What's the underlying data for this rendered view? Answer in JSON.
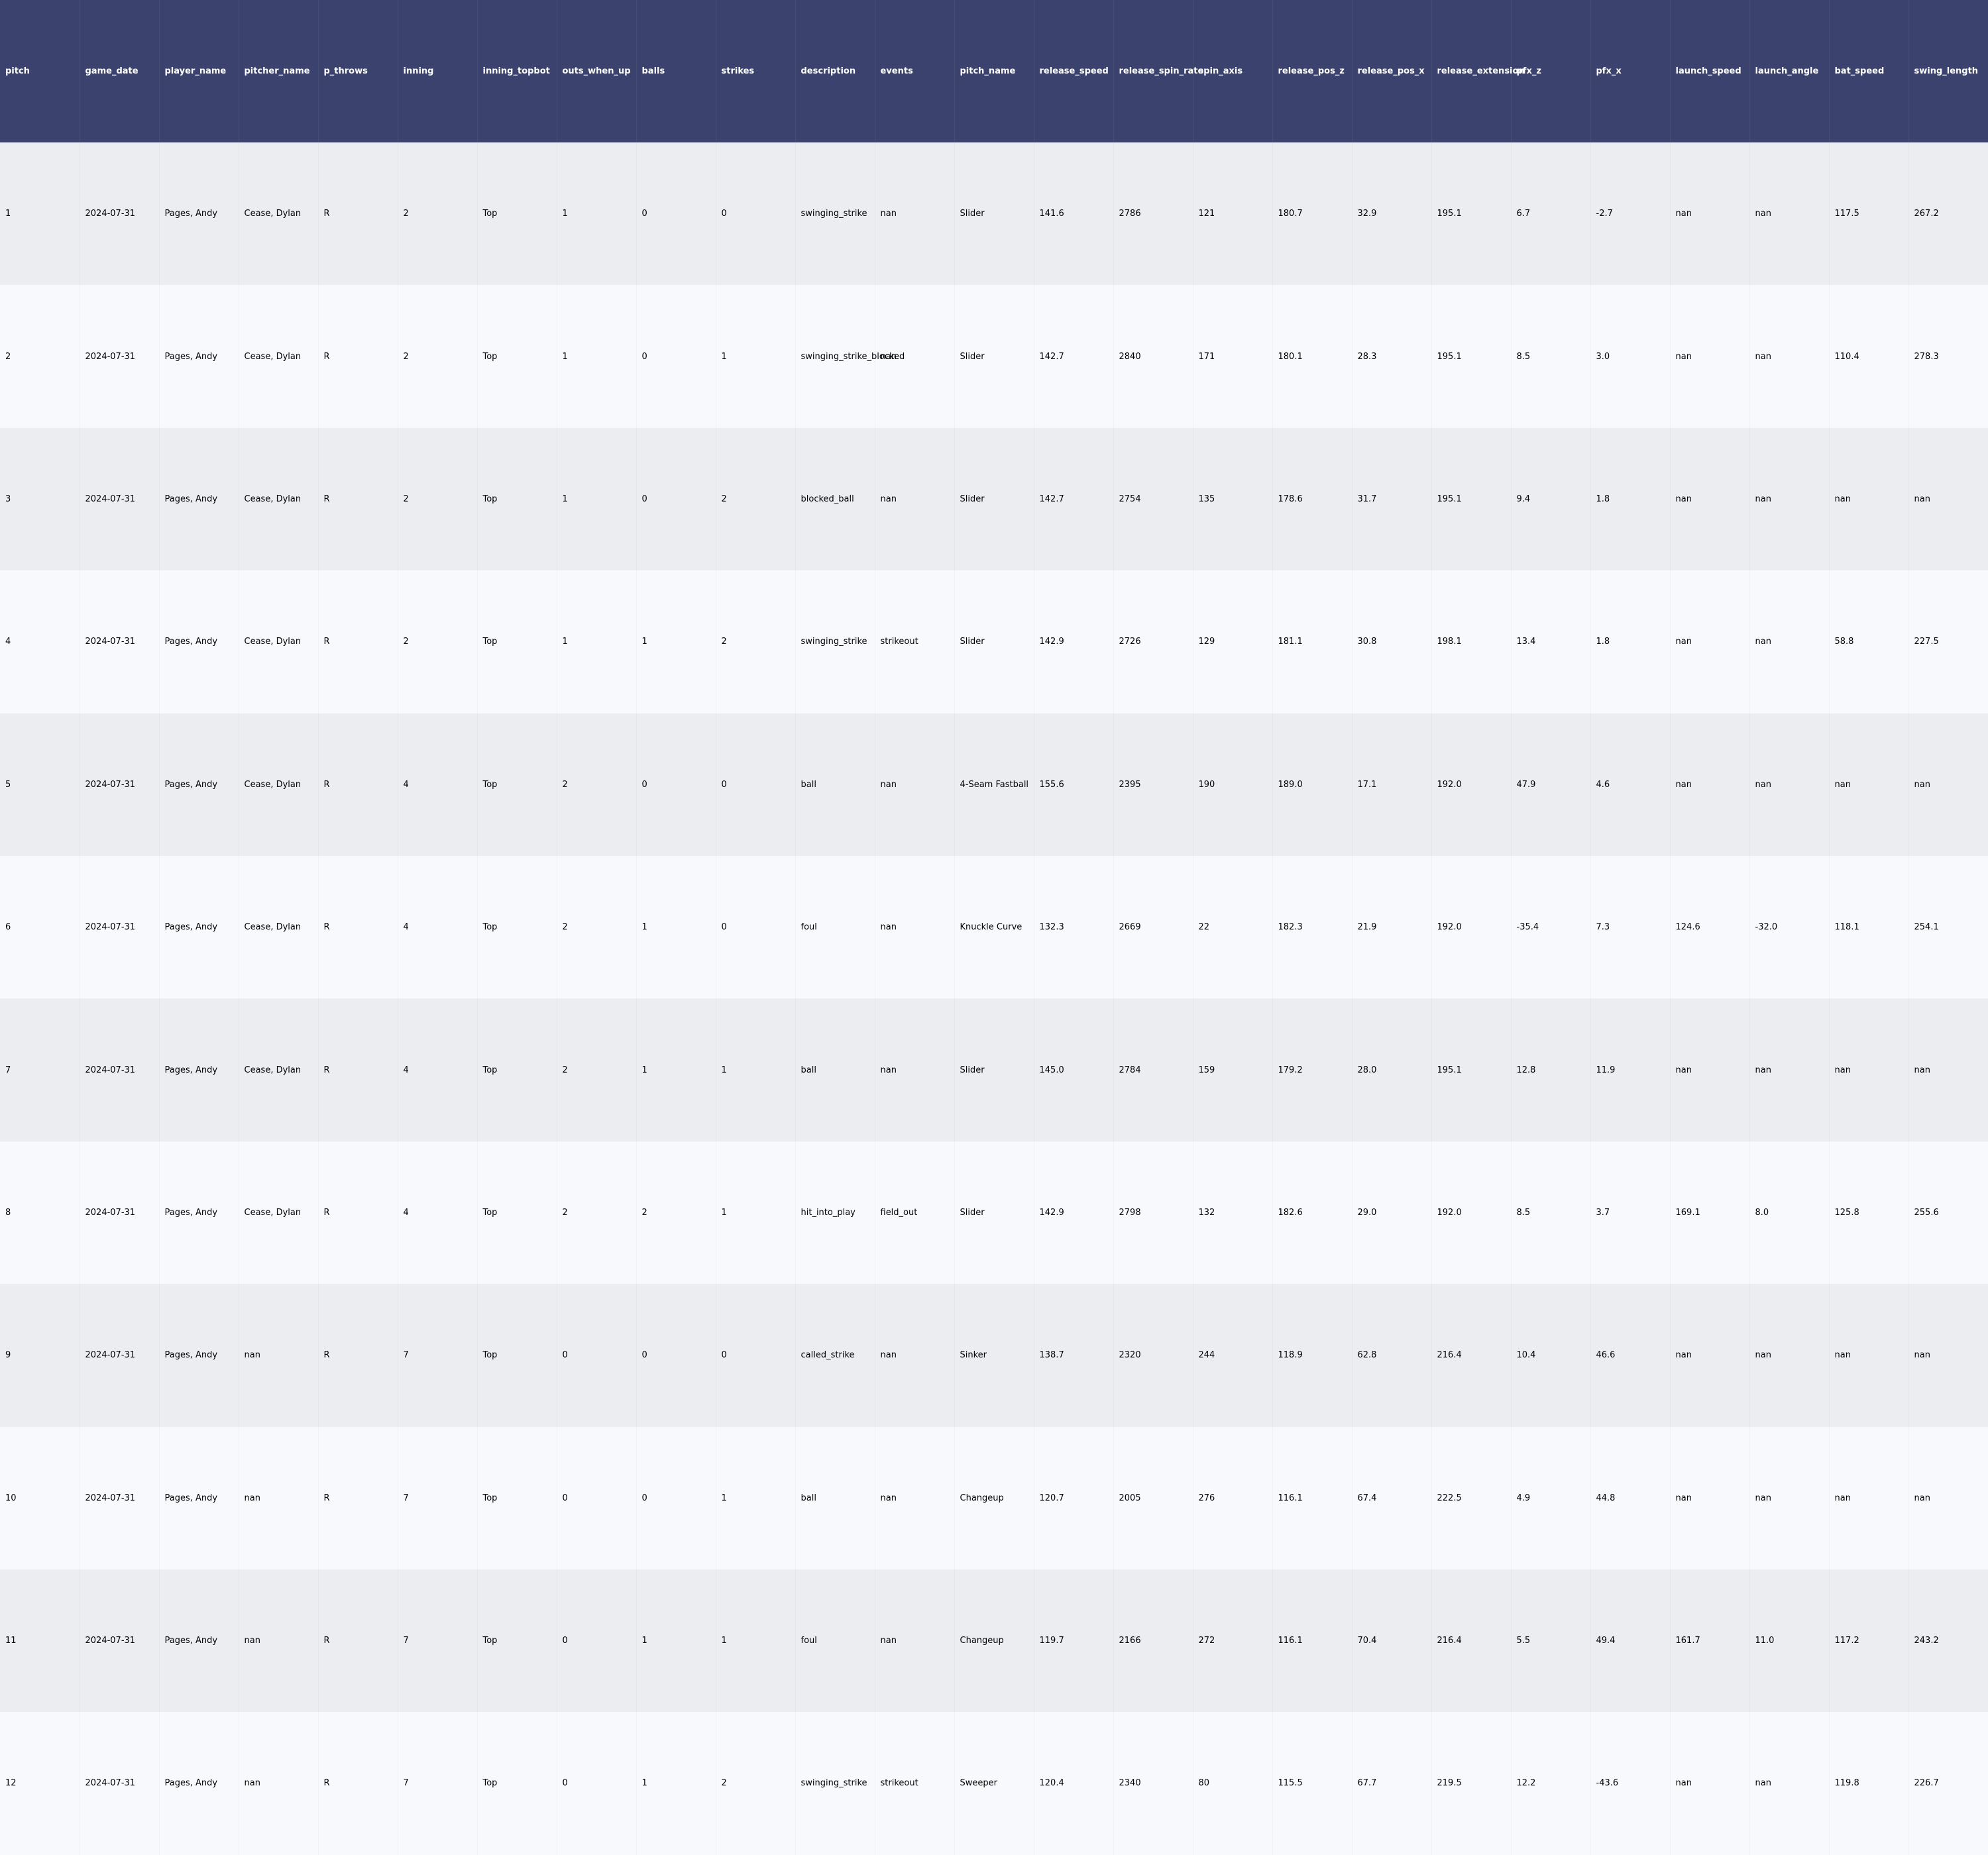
{
  "chart_data": {
    "type": "table",
    "columns": [
      "pitch",
      "game_date",
      "player_name",
      "pitcher_name",
      "p_throws",
      "inning",
      "inning_topbot",
      "outs_when_up",
      "balls",
      "strikes",
      "description",
      "events",
      "pitch_name",
      "release_speed",
      "release_spin_rate",
      "spin_axis",
      "release_pos_z",
      "release_pos_x",
      "release_extension",
      "pfx_z",
      "pfx_x",
      "launch_speed",
      "launch_angle",
      "bat_speed",
      "swing_length"
    ],
    "rows": [
      [
        "1",
        "2024-07-31",
        "Pages, Andy",
        "Cease, Dylan",
        "R",
        "2",
        "Top",
        "1",
        "0",
        "0",
        "swinging_strike",
        "nan",
        "Slider",
        "141.6",
        "2786",
        "121",
        "180.7",
        "32.9",
        "195.1",
        "6.7",
        "-2.7",
        "nan",
        "nan",
        "117.5",
        "267.2"
      ],
      [
        "2",
        "2024-07-31",
        "Pages, Andy",
        "Cease, Dylan",
        "R",
        "2",
        "Top",
        "1",
        "0",
        "1",
        "swinging_strike_blocked",
        "nan",
        "Slider",
        "142.7",
        "2840",
        "171",
        "180.1",
        "28.3",
        "195.1",
        "8.5",
        "3.0",
        "nan",
        "nan",
        "110.4",
        "278.3"
      ],
      [
        "3",
        "2024-07-31",
        "Pages, Andy",
        "Cease, Dylan",
        "R",
        "2",
        "Top",
        "1",
        "0",
        "2",
        "blocked_ball",
        "nan",
        "Slider",
        "142.7",
        "2754",
        "135",
        "178.6",
        "31.7",
        "195.1",
        "9.4",
        "1.8",
        "nan",
        "nan",
        "nan",
        "nan"
      ],
      [
        "4",
        "2024-07-31",
        "Pages, Andy",
        "Cease, Dylan",
        "R",
        "2",
        "Top",
        "1",
        "1",
        "2",
        "swinging_strike",
        "strikeout",
        "Slider",
        "142.9",
        "2726",
        "129",
        "181.1",
        "30.8",
        "198.1",
        "13.4",
        "1.8",
        "nan",
        "nan",
        "58.8",
        "227.5"
      ],
      [
        "5",
        "2024-07-31",
        "Pages, Andy",
        "Cease, Dylan",
        "R",
        "4",
        "Top",
        "2",
        "0",
        "0",
        "ball",
        "nan",
        "4-Seam Fastball",
        "155.6",
        "2395",
        "190",
        "189.0",
        "17.1",
        "192.0",
        "47.9",
        "4.6",
        "nan",
        "nan",
        "nan",
        "nan"
      ],
      [
        "6",
        "2024-07-31",
        "Pages, Andy",
        "Cease, Dylan",
        "R",
        "4",
        "Top",
        "2",
        "1",
        "0",
        "foul",
        "nan",
        "Knuckle Curve",
        "132.3",
        "2669",
        "22",
        "182.3",
        "21.9",
        "192.0",
        "-35.4",
        "7.3",
        "124.6",
        "-32.0",
        "118.1",
        "254.1"
      ],
      [
        "7",
        "2024-07-31",
        "Pages, Andy",
        "Cease, Dylan",
        "R",
        "4",
        "Top",
        "2",
        "1",
        "1",
        "ball",
        "nan",
        "Slider",
        "145.0",
        "2784",
        "159",
        "179.2",
        "28.0",
        "195.1",
        "12.8",
        "11.9",
        "nan",
        "nan",
        "nan",
        "nan"
      ],
      [
        "8",
        "2024-07-31",
        "Pages, Andy",
        "Cease, Dylan",
        "R",
        "4",
        "Top",
        "2",
        "2",
        "1",
        "hit_into_play",
        "field_out",
        "Slider",
        "142.9",
        "2798",
        "132",
        "182.6",
        "29.0",
        "192.0",
        "8.5",
        "3.7",
        "169.1",
        "8.0",
        "125.8",
        "255.6"
      ],
      [
        "9",
        "2024-07-31",
        "Pages, Andy",
        "nan",
        "R",
        "7",
        "Top",
        "0",
        "0",
        "0",
        "called_strike",
        "nan",
        "Sinker",
        "138.7",
        "2320",
        "244",
        "118.9",
        "62.8",
        "216.4",
        "10.4",
        "46.6",
        "nan",
        "nan",
        "nan",
        "nan"
      ],
      [
        "10",
        "2024-07-31",
        "Pages, Andy",
        "nan",
        "R",
        "7",
        "Top",
        "0",
        "0",
        "1",
        "ball",
        "nan",
        "Changeup",
        "120.7",
        "2005",
        "276",
        "116.1",
        "67.4",
        "222.5",
        "4.9",
        "44.8",
        "nan",
        "nan",
        "nan",
        "nan"
      ],
      [
        "11",
        "2024-07-31",
        "Pages, Andy",
        "nan",
        "R",
        "7",
        "Top",
        "0",
        "1",
        "1",
        "foul",
        "nan",
        "Changeup",
        "119.7",
        "2166",
        "272",
        "116.1",
        "70.4",
        "216.4",
        "5.5",
        "49.4",
        "161.7",
        "11.0",
        "117.2",
        "243.2"
      ],
      [
        "12",
        "2024-07-31",
        "Pages, Andy",
        "nan",
        "R",
        "7",
        "Top",
        "0",
        "1",
        "2",
        "swinging_strike",
        "strikeout",
        "Sweeper",
        "120.4",
        "2340",
        "80",
        "115.5",
        "67.7",
        "219.5",
        "12.2",
        "-43.6",
        "nan",
        "nan",
        "119.8",
        "226.7"
      ]
    ]
  },
  "colors": {
    "header_bg": "#3b426d",
    "header_text": "#ffffff",
    "row_odd": "#ecedf0",
    "row_even": "#f8f9fc"
  }
}
